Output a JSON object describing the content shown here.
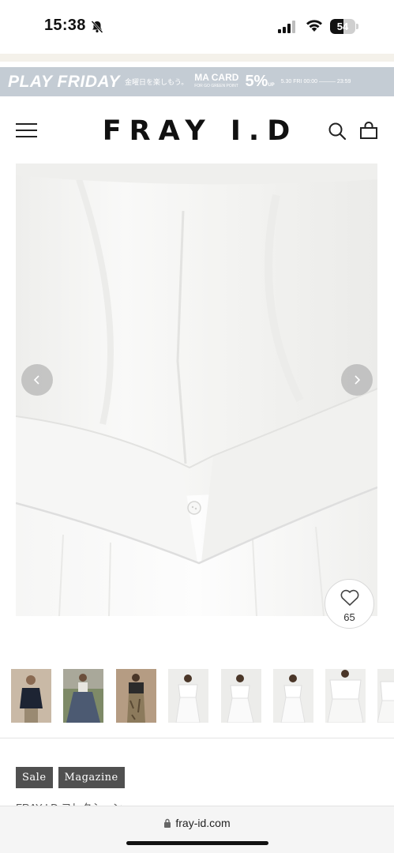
{
  "status_bar": {
    "time": "15:38",
    "battery": "54",
    "battery_level": 0.54
  },
  "promo_banner": {
    "title": "PLAY FRIDAY",
    "subtitle": "金曜日を楽しもう。",
    "card_name": "MA CARD",
    "card_sub": "FOR GO GREEN POINT",
    "percent": "5%",
    "percent_unit": "UP",
    "date": "5.30 FRI 00:00 ——— 23:59"
  },
  "header": {
    "logo": "FRAY I.D"
  },
  "product": {
    "favorite_count": "65"
  },
  "thumbnails": [
    {
      "name": "thumb-1",
      "bg": "#c9b9a6",
      "fg": "#1d2433"
    },
    {
      "name": "thumb-2",
      "bg": "#7e8a67",
      "fg": "#4c5a72"
    },
    {
      "name": "thumb-3",
      "bg": "#b59c83",
      "fg": "#2b2b2b"
    },
    {
      "name": "thumb-4",
      "bg": "#ededeb",
      "fg": "#ffffff"
    },
    {
      "name": "thumb-5",
      "bg": "#ececea",
      "fg": "#ffffff"
    },
    {
      "name": "thumb-6",
      "bg": "#eeeeec",
      "fg": "#ffffff"
    },
    {
      "name": "thumb-7",
      "bg": "#efefed",
      "fg": "#ffffff"
    },
    {
      "name": "thumb-8",
      "bg": "#eeeeec",
      "fg": "#ffffff"
    }
  ],
  "tags": [
    "Sale",
    "Magazine"
  ],
  "cut_text": "FRAY I.D コレクション",
  "browser": {
    "url": "fray-id.com"
  },
  "colors": {
    "banner": "#c4ccd4",
    "tag": "#505050",
    "beige_strip": "#f4f1ea"
  }
}
